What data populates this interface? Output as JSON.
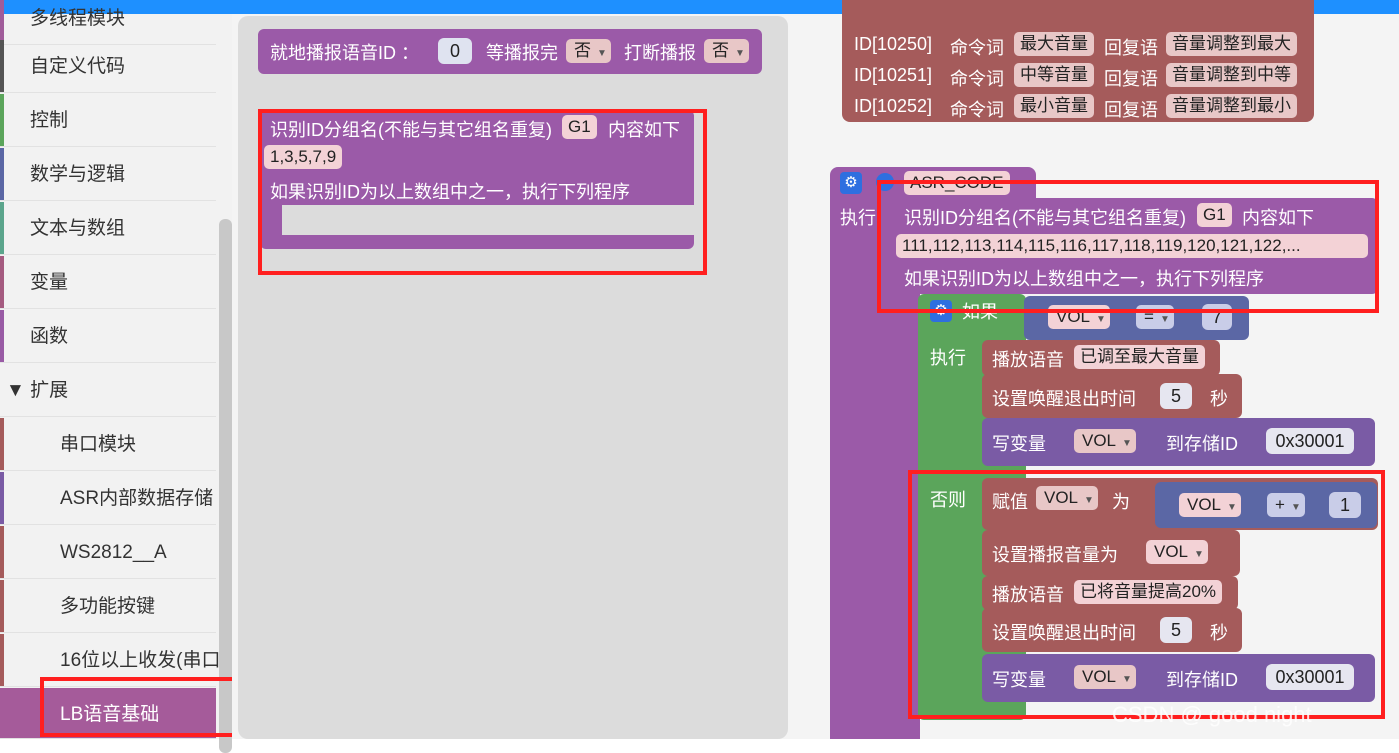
{
  "sidebar": {
    "items": [
      {
        "label": "多线程模块",
        "color": "#a05c9a"
      },
      {
        "label": "自定义代码",
        "color": "#555555"
      },
      {
        "label": "控制",
        "color": "#5ba55b"
      },
      {
        "label": "数学与逻辑",
        "color": "#5b67a5"
      },
      {
        "label": "文本与数组",
        "color": "#5ba58c"
      },
      {
        "label": "变量",
        "color": "#a55b80"
      },
      {
        "label": "函数",
        "color": "#995ba5"
      },
      {
        "label": "▼ 扩展",
        "color": "#a5745b"
      },
      {
        "label": "串口模块",
        "color": "#a55b5b"
      },
      {
        "label": "ASR内部数据存储",
        "color": "#7a5ba5"
      },
      {
        "label": "WS2812__A",
        "color": "#a55b5b"
      },
      {
        "label": "多功能按键",
        "color": "#a55b5b"
      },
      {
        "label": "16位以上收发(串口",
        "color": "#a55b5b"
      },
      {
        "label": "LB语音基础",
        "color": "#8e5ba5"
      }
    ]
  },
  "flyout": {
    "play_block": {
      "label": "就地播报语音ID ：",
      "num": "0",
      "wait_label": "等播报完",
      "wait_value": "否",
      "interrupt_label": "打断播报",
      "interrupt_value": "否"
    },
    "group_block": {
      "line1": "识别ID分组名(不能与其它组名重复)",
      "group_name": "G1",
      "line1_suffix": "内容如下",
      "ids": "1,3,5,7,9",
      "line3": "如果识别ID为以上数组中之一，执行下列程序"
    }
  },
  "commands": [
    {
      "id": "ID[10250]",
      "cmd_label": "命令词",
      "cmd": "最大音量",
      "reply_label": "回复语",
      "reply": "音量调整到最大"
    },
    {
      "id": "ID[10251]",
      "cmd_label": "命令词",
      "cmd": "中等音量",
      "reply_label": "回复语",
      "reply": "音量调整到中等"
    },
    {
      "id": "ID[10252]",
      "cmd_label": "命令词",
      "cmd": "最小音量",
      "reply_label": "回复语",
      "reply": "音量调整到最小"
    }
  ],
  "asr": {
    "name": "ASR_CODE",
    "exec_label": "执行",
    "group": {
      "line1": "识别ID分组名(不能与其它组名重复)",
      "group_name": "G1",
      "line1_suffix": "内容如下",
      "ids": "111,112,113,114,115,116,117,118,119,120,121,122,...",
      "line3": "如果识别ID为以上数组中之一，执行下列程序"
    },
    "if_label": "如果",
    "cond": {
      "var": "VOL",
      "op": "=",
      "value": "7"
    },
    "then_label": "执行",
    "then": {
      "play_label": "播放语音",
      "play_text": "已调至最大音量",
      "timeout_label": "设置唤醒退出时间",
      "timeout_value": "5",
      "timeout_unit": "秒",
      "write_label": "写变量",
      "write_var": "VOL",
      "write_to": "到存储ID",
      "write_addr": "0x30001"
    },
    "else_label": "否则",
    "else": {
      "assign_label": "赋值",
      "assign_var": "VOL",
      "assign_as": "为",
      "expr_var": "VOL",
      "expr_op": "+",
      "expr_val": "1",
      "volume_label": "设置播报音量为",
      "volume_var": "VOL",
      "play_label": "播放语音",
      "play_text": "已将音量提高20%",
      "timeout_label": "设置唤醒退出时间",
      "timeout_value": "5",
      "timeout_unit": "秒",
      "write_label": "写变量",
      "write_var": "VOL",
      "write_to": "到存储ID",
      "write_addr": "0x30001"
    }
  },
  "watermark": "CSDN @     good night",
  "colors": {
    "purple": "#9b5aa8",
    "green": "#5ba55b",
    "red": "#a55b5b",
    "blue": "#5b67a5",
    "highlight": "#ff1f1f",
    "topbar": "#1e90ff"
  }
}
